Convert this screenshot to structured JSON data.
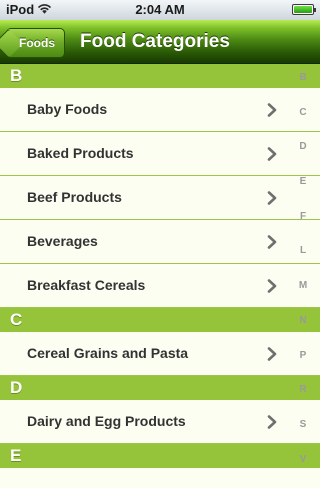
{
  "status_bar": {
    "carrier": "iPod",
    "time": "2:04 AM",
    "battery_level": 1.0
  },
  "nav": {
    "back_label": "Foods",
    "title": "Food Categories"
  },
  "sections": [
    {
      "letter": "B",
      "items": [
        "Baby Foods",
        "Baked Products",
        "Beef Products",
        "Beverages",
        "Breakfast Cereals"
      ]
    },
    {
      "letter": "C",
      "items": [
        "Cereal Grains and Pasta"
      ]
    },
    {
      "letter": "D",
      "items": [
        "Dairy and Egg Products"
      ]
    },
    {
      "letter": "E",
      "items": []
    }
  ],
  "index": [
    "B",
    "C",
    "D",
    "E",
    "F",
    "L",
    "M",
    "N",
    "P",
    "R",
    "S",
    "V"
  ],
  "colors": {
    "section_bg": "#95c33a",
    "row_bg": "#fdfef2",
    "separator": "#9cc649",
    "nav_dark": "#183a02"
  },
  "icons": {
    "row_accessory": "chevron-right-icon",
    "status_wifi": "wifi-icon",
    "status_battery": "battery-icon"
  }
}
